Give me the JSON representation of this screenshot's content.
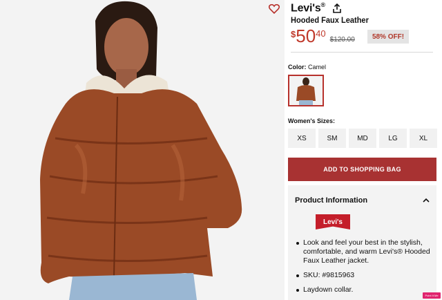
{
  "product": {
    "brand": "Levi's",
    "brand_trademark": "®",
    "name": "Hooded Faux Leather",
    "price_currency": "$",
    "price_whole": "50",
    "price_cents": "40",
    "original_price": "$120.00",
    "discount_badge": "58% OFF!"
  },
  "color": {
    "label": "Color:",
    "value": "Camel"
  },
  "sizes": {
    "label": "Women's Sizes:",
    "options": [
      "XS",
      "SM",
      "MD",
      "LG",
      "XL"
    ]
  },
  "cart": {
    "button_label": "ADD TO SHOPPING BAG"
  },
  "info": {
    "heading": "Product Information",
    "logo_text": "Levi's",
    "bullets": [
      "Look and feel your best in the stylish, comfortable, and warm Levi's® Hooded Faux Leather jacket.",
      "SKU: #9815963",
      "Laydown collar."
    ]
  },
  "overlay": {
    "badge_text": "Point It Me"
  },
  "colors": {
    "price_red": "#c0392b",
    "button_red": "#a83232",
    "jacket_brown": "#9a4a26"
  },
  "icons": [
    "heart-icon",
    "share-icon",
    "chevron-up-icon"
  ]
}
